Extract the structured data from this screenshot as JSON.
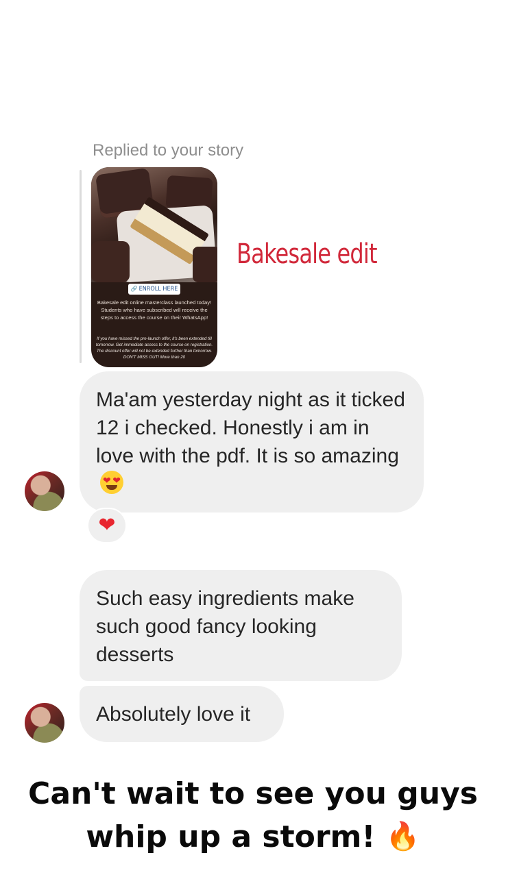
{
  "story_reply": {
    "note": "Replied to your story",
    "story": {
      "enroll_label": "ENROLL HERE",
      "caption": "Bakesale edit online masterclass launched today! Students who have subscribed will receive the steps to access the course on their WhatsApp!",
      "fine_print": "If you have missed the pre-launch offer, it's been extended till tomorrow. Get immediate access to the course on registration. The discount offer will not be extended further than tomorrow. DON'T MISS OUT! More than 20",
      "title": "Bakesale edit"
    }
  },
  "messages": [
    {
      "text": "Ma'am yesterday night as it ticked 12 i checked. Honestly i am in love with the pdf. It is so amazing",
      "emoji": "heart-eyes-emoji",
      "reaction": "❤"
    },
    {
      "text": "Such easy ingredients make such good fancy looking desserts"
    },
    {
      "text": "Absolutely love it"
    }
  ],
  "closing": {
    "line1": "Can't wait to see you guys",
    "line2": "whip up a storm!",
    "emoji": "🔥"
  },
  "colors": {
    "bubble": "#efefef",
    "story_title": "#d1283a",
    "reaction_heart": "#e8262f"
  }
}
